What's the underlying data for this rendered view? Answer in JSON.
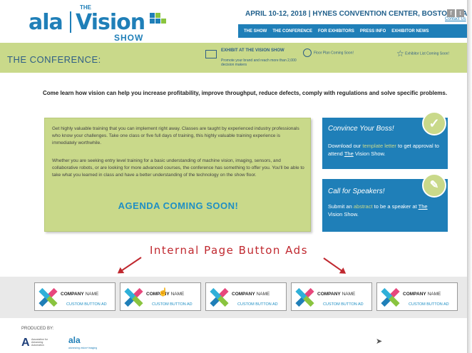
{
  "logo": {
    "ala": "ala",
    "the": "THE",
    "vision": "Vision",
    "show": "SHOW"
  },
  "header": {
    "event_line": "APRIL 10-12, 2018  |  HYNES CONVENTION CENTER, BOSTON, MA",
    "contact": "Contact Us",
    "social": [
      "f",
      "t"
    ],
    "nav": [
      "THE SHOW",
      "THE CONFERENCE",
      "FOR EXHIBITORS",
      "PRESS INFO",
      "EXHIBITOR NEWS"
    ]
  },
  "band": {
    "title": "THE CONFERENCE:",
    "exhibit_title": "EXHIBIT AT THE VISION SHOW",
    "exhibit_sub": "Promote your brand and reach more than 2,000 decision makers",
    "floor_plan": "Floor Plan Coming Soon!",
    "exhibitor_list": "Exhibitor List Coming Soon!"
  },
  "intro": "Come learn how vision can help you increase profitability, improve throughput, reduce defects, comply with regulations and solve specific problems.",
  "main": {
    "p1": "Get highly valuable training that you can implement right away. Classes are taught by experienced industry professionals who know your challenges. Take one class or five full days of training, this highly valuable training experience is immediately worthwhile.",
    "p2": "Whether you are seeking entry level training for a basic understanding of machine vision, imaging, sensors, and collaborative robots, or are looking for more advanced courses, the conference has something to offer you. You'll be able to take what you learned in class and have a better understanding of the technology on the show floor.",
    "agenda": "AGENDA COMING SOON!"
  },
  "cards": {
    "boss_title": "Convince Your Boss!",
    "boss_pre": "Download our ",
    "boss_link": "template letter",
    "boss_mid": " to get approval to attend ",
    "boss_the": "The",
    "boss_post": " Vision Show.",
    "speakers_title": "Call for Speakers!",
    "speakers_pre": "Submit an ",
    "speakers_link": "abstract",
    "speakers_mid": " to be a speaker at ",
    "speakers_the": "The",
    "speakers_post": " Vision Show."
  },
  "annotation": "Internal Page Button Ads",
  "ads": [
    {
      "company": "COMPANY",
      "name": "NAME",
      "custom": "CUSTOM BUTTON AD"
    },
    {
      "company": "COMPANY",
      "name": "NAME",
      "custom": "CUSTOM BUTTON AD"
    },
    {
      "company": "COMPANY",
      "name": "NAME",
      "custom": "CUSTOM BUTTON AD"
    },
    {
      "company": "COMPANY",
      "name": "NAME",
      "custom": "CUSTOM BUTTON AD"
    },
    {
      "company": "COMPANY",
      "name": "NAME",
      "custom": "CUSTOM BUTTON AD"
    }
  ],
  "footer": {
    "produced_by": "PRODUCED BY:",
    "a3_text": "Association for Advancing Automation",
    "ala": "ala",
    "ala_sub": "advancing vision+imaging"
  },
  "colors": {
    "brand_blue": "#1f7fb8",
    "brand_green": "#c9d98a",
    "annotation_red": "#c0282f"
  }
}
